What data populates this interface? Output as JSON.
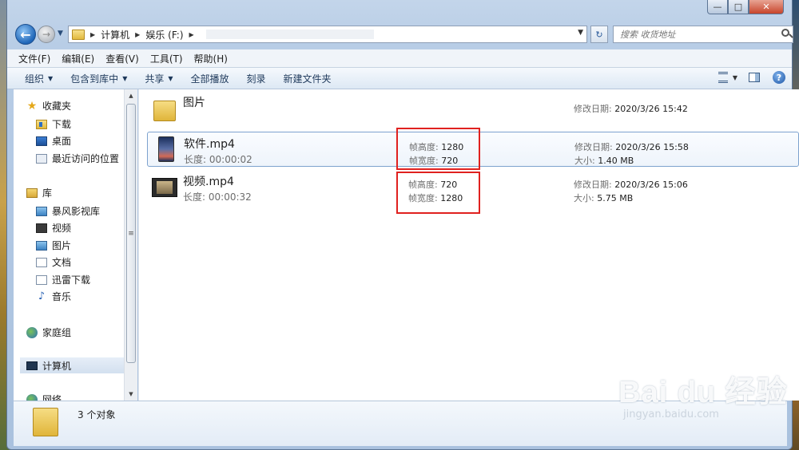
{
  "window": {
    "caption": {
      "minimize": "—",
      "maximize": "□",
      "close": "✕"
    }
  },
  "nav": {
    "back": "←",
    "forward": "→",
    "breadcrumbs": [
      "计算机",
      "娱乐 (F:)"
    ],
    "refresh": "↻",
    "search_placeholder": "搜索 收货地址"
  },
  "menu": [
    "文件(F)",
    "编辑(E)",
    "查看(V)",
    "工具(T)",
    "帮助(H)"
  ],
  "toolbar": {
    "items": [
      "组织",
      "包含到库中",
      "共享",
      "全部播放",
      "刻录",
      "新建文件夹"
    ],
    "help": "?"
  },
  "sidebar": {
    "favorites_header": "收藏夹",
    "favorites": [
      "下载",
      "桌面",
      "最近访问的位置"
    ],
    "library_header": "库",
    "libraries": [
      "暴风影视库",
      "视频",
      "图片",
      "文档",
      "迅雷下载",
      "音乐"
    ],
    "homegroup": "家庭组",
    "computer": "计算机",
    "network": "网络"
  },
  "scrollbar": {
    "up": "▲",
    "down": "▼",
    "grip": "≡"
  },
  "files": [
    {
      "name": "图片",
      "modified_label": "修改日期:",
      "modified": "2020/3/26 15:42"
    },
    {
      "name": "软件.mp4",
      "length_label": "长度:",
      "length": "00:00:02",
      "height_label": "帧高度:",
      "height": "1280",
      "width_label": "帧宽度:",
      "width": "720",
      "modified_label": "修改日期:",
      "modified": "2020/3/26 15:58",
      "size_label": "大小:",
      "size": "1.40 MB"
    },
    {
      "name": "视频.mp4",
      "length_label": "长度:",
      "length": "00:00:32",
      "height_label": "帧高度:",
      "height": "720",
      "width_label": "帧宽度:",
      "width": "1280",
      "modified_label": "修改日期:",
      "modified": "2020/3/26 15:06",
      "size_label": "大小:",
      "size": "5.75 MB"
    }
  ],
  "details": {
    "count": "3 个对象"
  },
  "watermark": {
    "logo": "Bai du 经验",
    "site": "jingyan.baidu.com"
  }
}
